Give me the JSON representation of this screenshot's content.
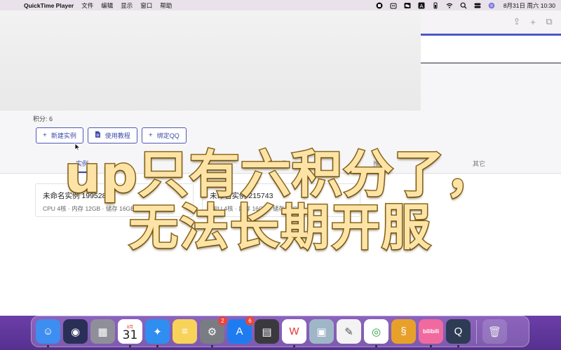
{
  "menubar": {
    "apple_glyph": "",
    "app_name": "QuickTime Player",
    "menus": [
      "文件",
      "编辑",
      "显示",
      "窗口",
      "帮助"
    ],
    "clock": "8月31日 周六  10:30"
  },
  "page": {
    "points_label": "积分: 6",
    "buttons": [
      {
        "icon": "+",
        "label": "新建实例"
      },
      {
        "icon": "doc",
        "label": "使用教程"
      },
      {
        "icon": "+",
        "label": "绑定QQ"
      }
    ],
    "tabs": [
      "实例",
      "",
      "记录",
      "推荐",
      "其它"
    ],
    "instances": [
      {
        "name": "未命名实例 199528",
        "specs": "CPU 4核 · 内存 12GB · 储存 16GB"
      },
      {
        "name": "未命名实例 215743",
        "specs": "CPU 4核 · 内存 16GB · 储存 16GB"
      }
    ]
  },
  "caption": {
    "line1": "up只有六积分了，",
    "line2": "无法长期开服"
  },
  "dock": {
    "calendar_month": "8月",
    "calendar_day": "31",
    "apps": [
      {
        "name": "finder-icon",
        "color": "#3d8ef0",
        "glyph": "☺"
      },
      {
        "name": "siri-icon",
        "color": "#2a2f58",
        "glyph": "◉"
      },
      {
        "name": "launchpad-icon",
        "color": "#8f8f9a",
        "glyph": "▦"
      },
      {
        "name": "calendar-icon",
        "color": "#ffffff",
        "glyph": ""
      },
      {
        "name": "safari-icon",
        "color": "#2f8ef0",
        "glyph": "✦"
      },
      {
        "name": "notes-icon",
        "color": "#f7d35a",
        "glyph": "≡"
      },
      {
        "name": "system-preferences-icon",
        "color": "#7a7c83",
        "glyph": "⚙",
        "badge": "2"
      },
      {
        "name": "app-store-icon",
        "color": "#1f7cf0",
        "glyph": "A",
        "badge": "6"
      },
      {
        "name": "calculator-icon",
        "color": "#3a3a3e",
        "glyph": "▤"
      },
      {
        "name": "wps-icon",
        "color": "#ffffff",
        "glyph": "W",
        "fg": "#e0352b"
      },
      {
        "name": "preview-icon",
        "color": "#9fb6c8",
        "glyph": "▣"
      },
      {
        "name": "textedit-icon",
        "color": "#f3f3f3",
        "glyph": "✎",
        "fg": "#555"
      },
      {
        "name": "chrome-icon",
        "color": "#ffffff",
        "glyph": "◎",
        "fg": "#2f9e44"
      },
      {
        "name": "scrivener-icon",
        "color": "#e7a12a",
        "glyph": "§"
      },
      {
        "name": "bilibili-icon",
        "color": "#f06aa0",
        "glyph": "bilibili"
      },
      {
        "name": "quicktime-icon",
        "color": "#2d3b55",
        "glyph": "Q"
      }
    ],
    "trash": {
      "name": "trash-icon",
      "glyph": "🗑"
    }
  }
}
